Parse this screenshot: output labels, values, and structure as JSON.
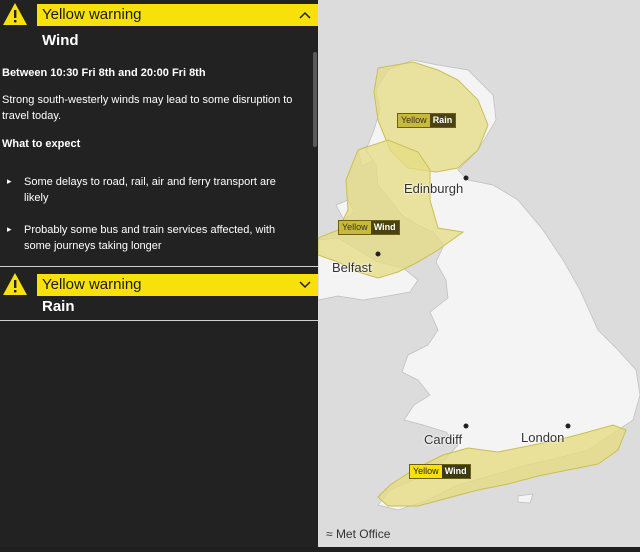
{
  "warnings": [
    {
      "level": "Yellow warning",
      "type": "Wind",
      "expanded": true,
      "period": "Between 10:30 Fri 8th and 20:00 Fri 8th",
      "description": "Strong south-westerly winds may lead to some disruption to travel today.",
      "expect_heading": "What to expect",
      "bullets": [
        "Some delays to road, rail, air and ferry transport are likely",
        "Probably some bus and train services affected, with some journeys taking longer"
      ]
    },
    {
      "level": "Yellow warning",
      "type": "Rain",
      "expanded": false
    }
  ],
  "map": {
    "cities": [
      "Edinburgh",
      "Belfast",
      "Cardiff",
      "London"
    ],
    "badges": [
      {
        "level": "Yellow",
        "type": "Rain"
      },
      {
        "level": "Yellow",
        "type": "Wind"
      },
      {
        "level": "Yellow",
        "type": "Wind"
      }
    ],
    "attribution": "Met Office"
  },
  "colors": {
    "warning_yellow": "#f8e10a",
    "panel_bg": "#222222",
    "sea": "#dcdcdc",
    "land": "#f4f4f4",
    "warning_area": "#e6dc82"
  }
}
